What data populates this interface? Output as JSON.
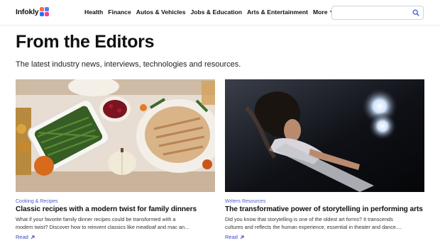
{
  "header": {
    "logo_text": "Infokly",
    "nav": [
      "Health",
      "Finance",
      "Autos & Vehicles",
      "Jobs & Education",
      "Arts & Entertainment"
    ],
    "more_label": "More",
    "search": {
      "value": "",
      "placeholder": ""
    }
  },
  "main": {
    "title": "From the Editors",
    "subtitle": "The latest industry news, interviews, technologies and resources."
  },
  "cards": [
    {
      "category": "Cooking & Recipes",
      "title": "Classic recipes with a modern twist for family dinners",
      "desc_line1": "What if your favorite family dinner recipes could be transformed with a",
      "desc_line2": "modern twist? Discover how to reinvent classics like meatloaf and mac an...",
      "read_label": "Read"
    },
    {
      "category": "Writers Resources",
      "title": "The transformative power of storytelling in performing arts",
      "desc_line1": "Did you know that storytelling is one of the oldest art forms? It transcends",
      "desc_line2": "cultures and reflects the human experience, essential in theater and dance....",
      "read_label": "Read"
    }
  ],
  "colors": {
    "accent": "#3b4cc0",
    "category": "#4a5cd1"
  },
  "icons": [
    "search-icon",
    "chevron-down-icon",
    "arrow-up-right-icon"
  ]
}
